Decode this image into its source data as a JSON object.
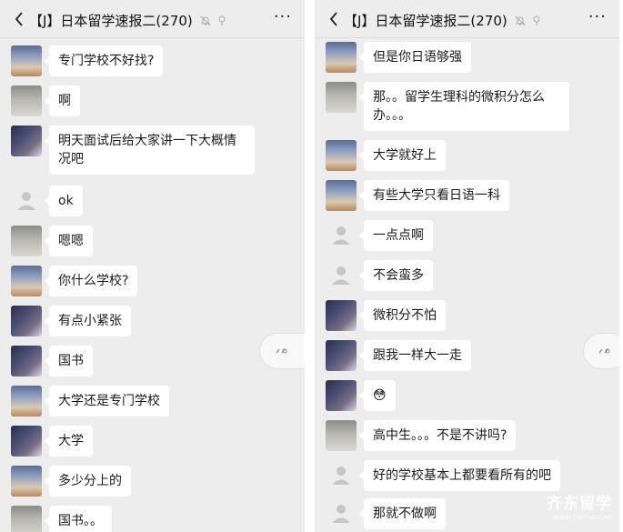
{
  "left": {
    "title": "【J】日本留学速报二(270)",
    "more": "···",
    "messages": [
      {
        "avatar": "fox",
        "text": "专门学校不好找?"
      },
      {
        "avatar": "photo",
        "text": "啊"
      },
      {
        "avatar": "anime",
        "text": "明天面试后给大家讲一下大概情况吧"
      },
      {
        "avatar": "default",
        "text": "ok"
      },
      {
        "avatar": "photo",
        "text": "嗯嗯"
      },
      {
        "avatar": "fox",
        "text": "你什么学校?"
      },
      {
        "avatar": "anime",
        "text": "有点小紧张"
      },
      {
        "avatar": "anime",
        "text": "国书"
      },
      {
        "avatar": "fox",
        "text": "大学还是专门学校"
      },
      {
        "avatar": "anime",
        "text": "大学"
      },
      {
        "avatar": "fox",
        "text": "多少分上的"
      },
      {
        "avatar": "photo",
        "text": "国书。。"
      }
    ]
  },
  "right": {
    "title": "【J】日本留学速报二(270)",
    "more": "···",
    "messages": [
      {
        "avatar": "fox",
        "text": "但是你日语够强"
      },
      {
        "avatar": "photo",
        "text": "那。。留学生理科的微积分怎么办。。。"
      },
      {
        "avatar": "fox",
        "text": "大学就好上"
      },
      {
        "avatar": "fox",
        "text": "有些大学只看日语一科"
      },
      {
        "avatar": "default",
        "text": "一点点啊"
      },
      {
        "avatar": "default",
        "text": "不会蛮多"
      },
      {
        "avatar": "anime",
        "text": "微积分不怕"
      },
      {
        "avatar": "anime",
        "text": "跟我一样大一走"
      },
      {
        "avatar": "anime",
        "text": "😳"
      },
      {
        "avatar": "photo",
        "text": "高中生。。。不是不讲吗?"
      },
      {
        "avatar": "default",
        "text": "好的学校基本上都要看所有的吧"
      },
      {
        "avatar": "default",
        "text": "那就不做啊"
      }
    ]
  },
  "watermark": {
    "main": "齐东留学",
    "sub": "www.jiemo.net"
  }
}
